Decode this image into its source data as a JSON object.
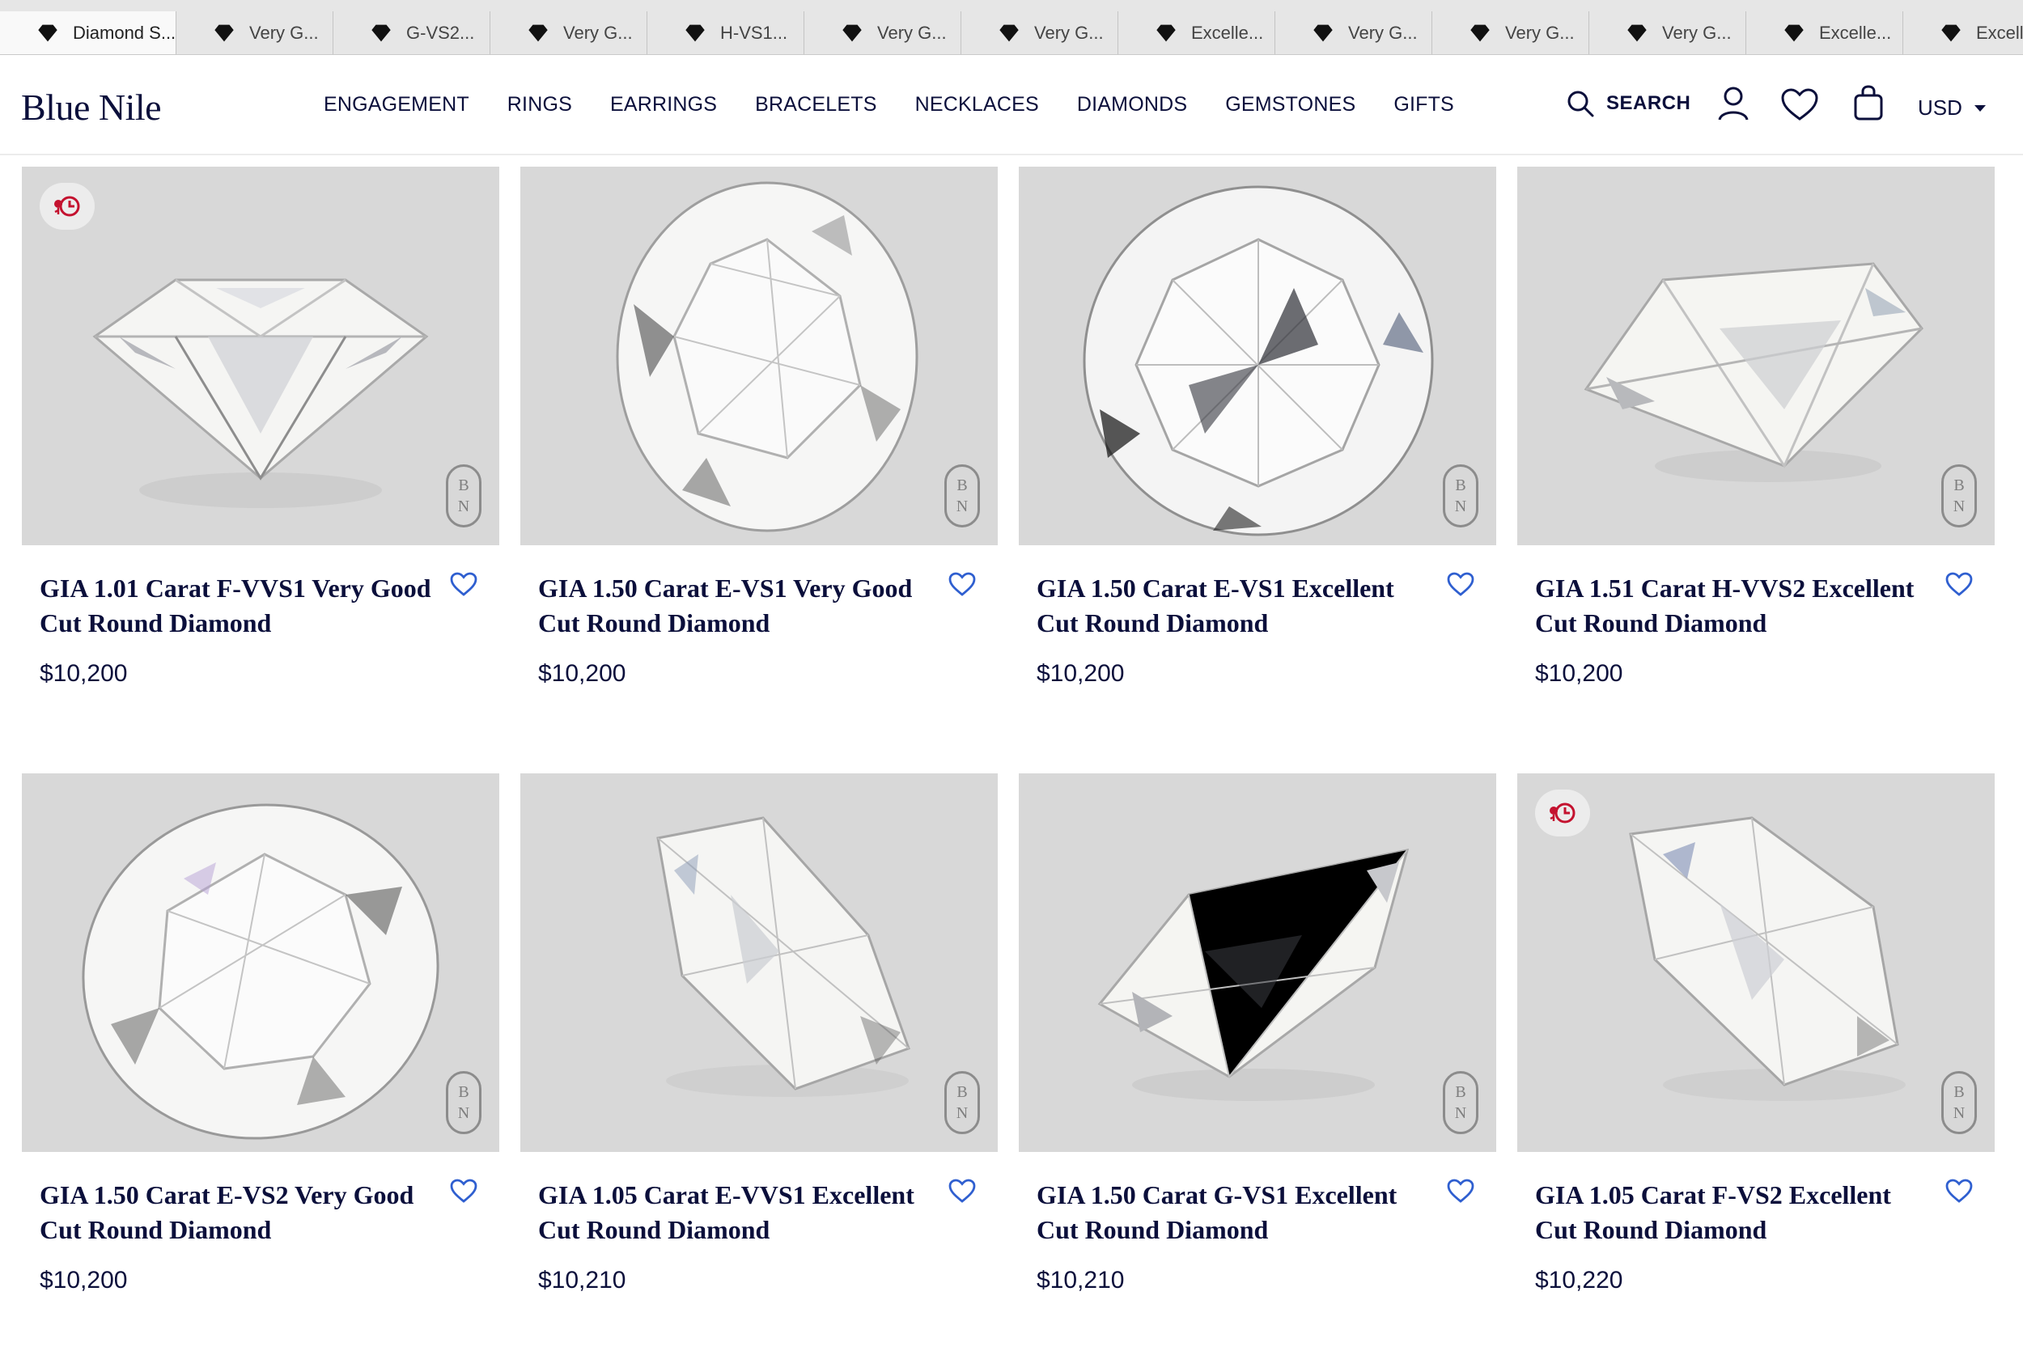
{
  "browser_tabs": [
    {
      "label": "Diamond S...",
      "active": true
    },
    {
      "label": "Very G..."
    },
    {
      "label": "G-VS2..."
    },
    {
      "label": "Very G..."
    },
    {
      "label": "H-VS1..."
    },
    {
      "label": "Very G..."
    },
    {
      "label": "Very G..."
    },
    {
      "label": "Excelle..."
    },
    {
      "label": "Very G..."
    },
    {
      "label": "Very G..."
    },
    {
      "label": "Very G..."
    },
    {
      "label": "Excelle..."
    },
    {
      "label": "Excelle..."
    }
  ],
  "header": {
    "logo": "Blue Nile",
    "nav": [
      "ENGAGEMENT",
      "RINGS",
      "EARRINGS",
      "BRACELETS",
      "NECKLACES",
      "DIAMONDS",
      "GEMSTONES",
      "GIFTS"
    ],
    "search_label": "SEARCH",
    "currency": "USD"
  },
  "colors": {
    "navy": "#0b0f3b",
    "wishlist_heart": "#2f5fd0",
    "badge_red": "#c4122f",
    "photo_background": "#d8d8d8"
  },
  "watermark": {
    "top": "B",
    "bottom": "N"
  },
  "products": [
    {
      "title": "GIA 1.01 Carat F-VVS1 Very Good Cut Round Diamond",
      "price": "$10,200",
      "badge": true
    },
    {
      "title": "GIA 1.50 Carat E-VS1 Very Good Cut Round Diamond",
      "price": "$10,200",
      "badge": false
    },
    {
      "title": "GIA 1.50 Carat E-VS1 Excellent Cut Round Diamond",
      "price": "$10,200",
      "badge": false
    },
    {
      "title": "GIA 1.51 Carat H-VVS2 Excellent Cut Round Diamond",
      "price": "$10,200",
      "badge": false
    },
    {
      "title": "GIA 1.50 Carat E-VS2 Very Good Cut Round Diamond",
      "price": "$10,200",
      "badge": false
    },
    {
      "title": "GIA 1.05 Carat E-VVS1 Excellent Cut Round Diamond",
      "price": "$10,210",
      "badge": false
    },
    {
      "title": "GIA 1.50 Carat G-VS1 Excellent Cut Round Diamond",
      "price": "$10,210",
      "badge": false
    },
    {
      "title": "GIA 1.05 Carat F-VS2 Excellent Cut Round Diamond",
      "price": "$10,220",
      "badge": true
    }
  ]
}
